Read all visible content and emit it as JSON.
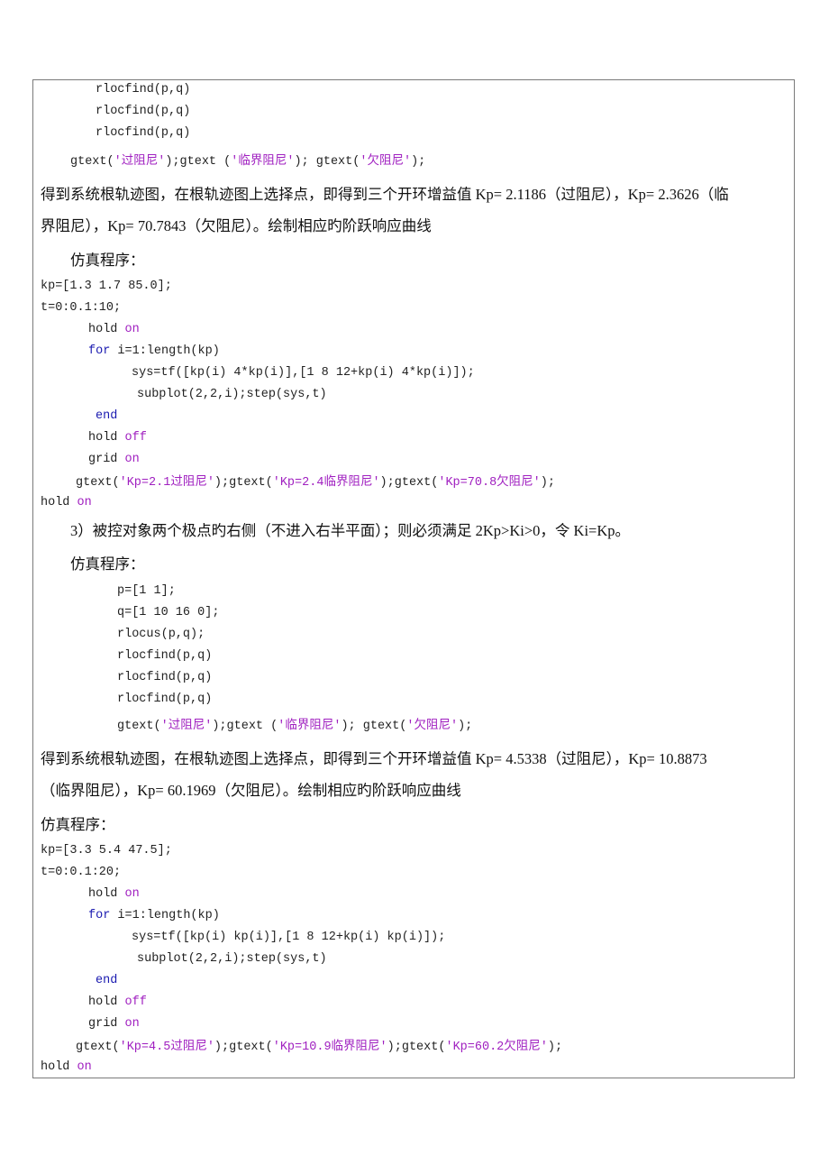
{
  "document": {
    "block1_code": {
      "rlocfind_1": "rlocfind(p,q)",
      "rlocfind_2": "rlocfind(p,q)",
      "rlocfind_3": "rlocfind(p,q)",
      "gtext_line": {
        "p1": "gtext(",
        "s1": "'过阻尼'",
        "p2": ");gtext (",
        "s2": "'临界阻尼'",
        "p3": "); gtext(",
        "s3": "'欠阻尼'",
        "p4": ");"
      }
    },
    "result1": {
      "line1": "得到系统根轨迹图，在根轨迹图上选择点，即得到三个开环增益值 Kp= 2.1186（过阻尼），Kp= 2.3626（临",
      "line2": "界阻尼），Kp= 70.7843（欠阻尼）。绘制相应旳阶跃响应曲线"
    },
    "sim_label_1": "仿真程序：",
    "block2_code": {
      "kp": "kp=[1.3 1.7 85.0];",
      "t": "t=0:0.1:10;",
      "hold_on": {
        "cmd": "hold ",
        "arg": "on"
      },
      "for": {
        "kw": "for",
        "rest": " i=1:length(kp)"
      },
      "sys": "sys=tf([kp(i) 4*kp(i)],[1 8 12+kp(i) 4*kp(i)]);",
      "subplot": "subplot(2,2,i);step(sys,t)",
      "end": "end",
      "hold_off": {
        "cmd": "hold ",
        "arg": "off"
      },
      "grid_on": {
        "cmd": "grid ",
        "arg": "on"
      },
      "gtext_line": {
        "p1": "gtext(",
        "s1": "'Kp=2.1过阻尼'",
        "p2": ");gtext(",
        "s2": "'Kp=2.4临界阻尼'",
        "p3": ");gtext(",
        "s3": "'Kp=70.8欠阻尼'",
        "p4": ");"
      },
      "final_hold": {
        "cmd": "hold ",
        "arg": "on"
      }
    },
    "section3_heading": "3）被控对象两个极点旳右侧（不进入右半平面）；则必须满足 2Kp>Ki>0，令 Ki=Kp。",
    "sim_label_2": "仿真程序：",
    "block3_code": {
      "p": "p=[1 1];",
      "q": "q=[1 10 16 0];",
      "rlocus": "rlocus(p,q);",
      "rlocfind_1": "rlocfind(p,q)",
      "rlocfind_2": "rlocfind(p,q)",
      "rlocfind_3": "rlocfind(p,q)",
      "gtext_line": {
        "p1": "gtext(",
        "s1": "'过阻尼'",
        "p2": ");gtext (",
        "s2": "'临界阻尼'",
        "p3": "); gtext(",
        "s3": "'欠阻尼'",
        "p4": ");"
      }
    },
    "result2": {
      "line1": "得到系统根轨迹图，在根轨迹图上选择点，即得到三个开环增益值 Kp= 4.5338（过阻尼），Kp= 10.8873",
      "line2": "（临界阻尼），Kp= 60.1969（欠阻尼）。绘制相应旳阶跃响应曲线"
    },
    "sim_label_3": "仿真程序：",
    "block4_code": {
      "kp": "kp=[3.3 5.4 47.5];",
      "t": "t=0:0.1:20;",
      "hold_on": {
        "cmd": "hold ",
        "arg": "on"
      },
      "for": {
        "kw": "for",
        "rest": " i=1:length(kp)"
      },
      "sys": "sys=tf([kp(i) kp(i)],[1 8 12+kp(i) kp(i)]);",
      "subplot": "subplot(2,2,i);step(sys,t)",
      "end": "end",
      "hold_off": {
        "cmd": "hold ",
        "arg": "off"
      },
      "grid_on": {
        "cmd": "grid ",
        "arg": "on"
      },
      "gtext_line": {
        "p1": "gtext(",
        "s1": "'Kp=4.5过阻尼'",
        "p2": ");gtext(",
        "s2": "'Kp=10.9临界阻尼'",
        "p3": ");gtext(",
        "s3": "'Kp=60.2欠阻尼'",
        "p4": ");"
      },
      "final_hold": {
        "cmd": "hold ",
        "arg": "on"
      }
    }
  }
}
